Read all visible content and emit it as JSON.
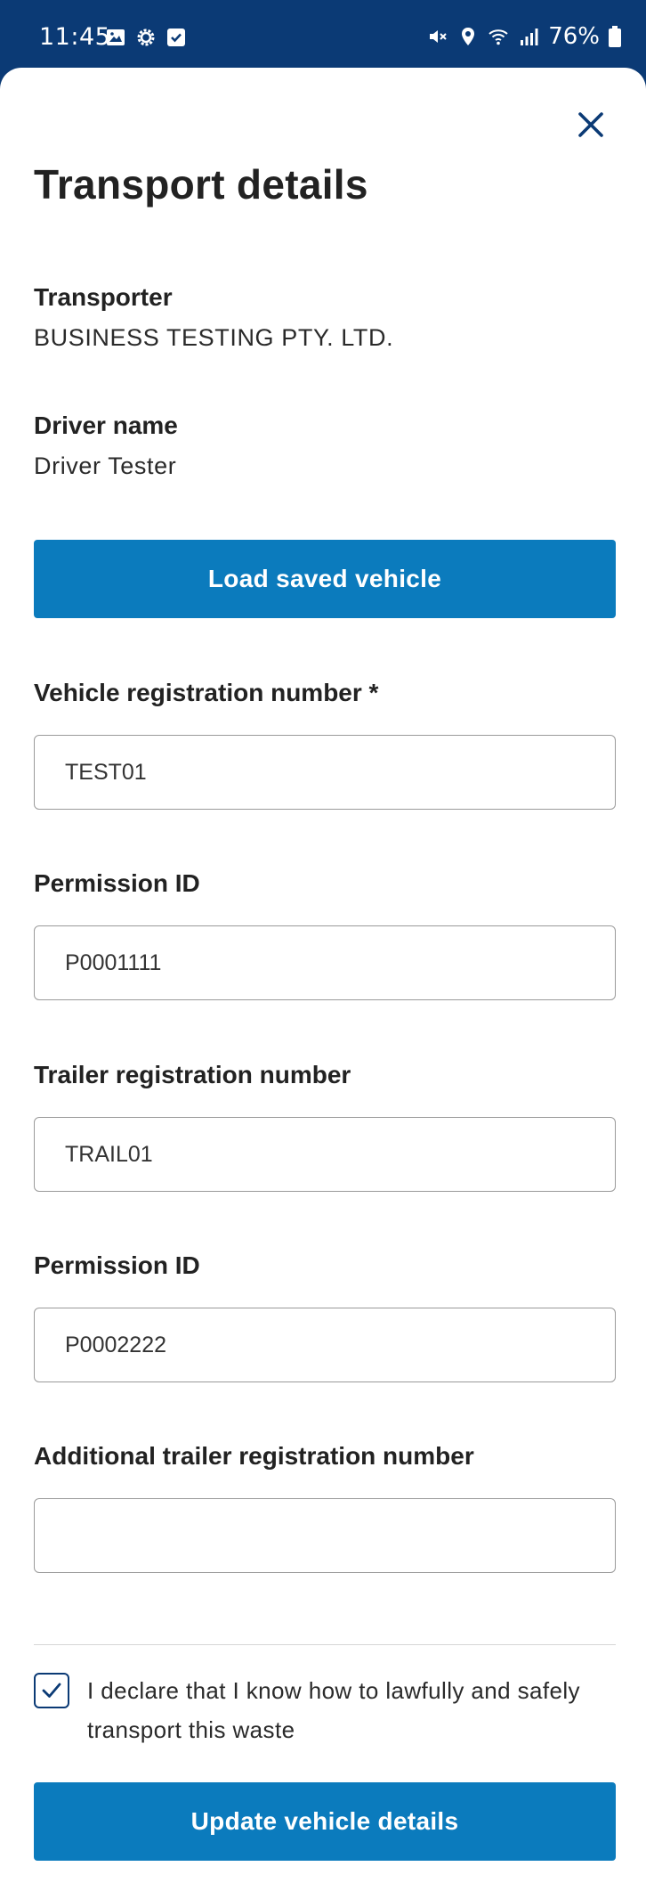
{
  "status_bar": {
    "time": "11:45",
    "battery": "76%",
    "icons": [
      "gallery-icon",
      "settings-icon",
      "check-square-icon",
      "mute-icon",
      "location-icon",
      "wifi-icon",
      "signal-icon",
      "battery-icon"
    ]
  },
  "sheet": {
    "close_icon": "close-icon",
    "title": "Transport details"
  },
  "transporter": {
    "label": "Transporter",
    "value": "BUSINESS TESTING PTY. LTD."
  },
  "driver": {
    "label": "Driver name",
    "value": "Driver Tester"
  },
  "load_button": {
    "label": "Load saved vehicle"
  },
  "fields": {
    "vehicle_registration": {
      "label": "Vehicle registration number *",
      "value": "TEST01"
    },
    "vehicle_permission": {
      "label": "Permission ID",
      "value": "P0001111"
    },
    "trailer_registration": {
      "label": "Trailer registration number",
      "value": "TRAIL01"
    },
    "trailer_permission": {
      "label": "Permission ID",
      "value": "P0002222"
    },
    "additional_trailer": {
      "label": "Additional trailer registration number",
      "value": ""
    }
  },
  "declaration": {
    "checked": true,
    "text": "I declare that I know how to lawfully and safely transport this waste"
  },
  "submit_button": {
    "label": "Update vehicle details"
  },
  "colors": {
    "brand_dark": "#0b3a75",
    "primary_button": "#0b7bbd"
  }
}
